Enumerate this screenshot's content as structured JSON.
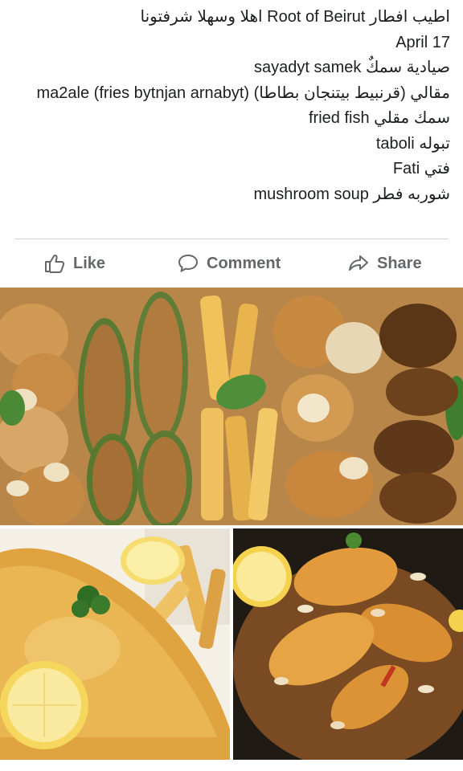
{
  "post": {
    "lines": [
      "اطيب افطار  Root of Beirut اهلا وسهلا شرفتونا",
      "April 17",
      "صيادية سمكٌ sayadyt samek",
      "مقالي (قرنبيط بيتنجان بطاطا) ma2ale (fries bytnjan arnabyt)",
      "سمك مقلي fried fish",
      "تبوله taboli",
      "فتي Fati",
      "شوربه فطر mushroom soup"
    ]
  },
  "actions": {
    "like": "Like",
    "comment": "Comment",
    "share": "Share"
  },
  "photos": [
    {
      "name": "fried-vegetables-platter-photo"
    },
    {
      "name": "fried-fish-with-fries-photo"
    },
    {
      "name": "fish-sayadieh-platter-photo"
    }
  ],
  "colors": {
    "action_text": "#65676b",
    "divider": "#ced0d4"
  }
}
